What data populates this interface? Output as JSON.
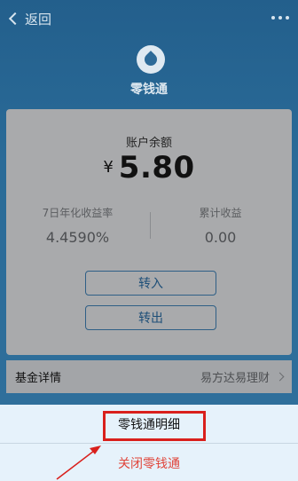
{
  "nav": {
    "back_label": "返回"
  },
  "header": {
    "title": "零钱通"
  },
  "account": {
    "balance_label": "账户余额",
    "currency_symbol": "¥",
    "balance": "5.80",
    "yield_label": "7日年化收益率",
    "yield_value": "4.4590%",
    "earnings_label": "累计收益",
    "earnings_value": "0.00",
    "transfer_in_label": "转入",
    "transfer_out_label": "转出"
  },
  "fund": {
    "label": "基金详情",
    "value": "易方达易理财"
  },
  "sheet": {
    "detail_label": "零钱通明细",
    "close_label": "关闭零钱通"
  },
  "colors": {
    "accent": "#2f6f9b",
    "highlight": "#d9201c",
    "danger": "#e0453a"
  }
}
